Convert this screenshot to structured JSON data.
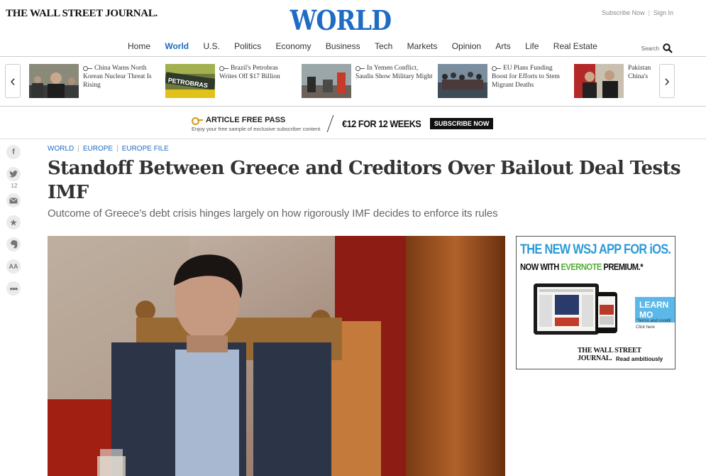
{
  "header": {
    "brand": "THE WALL STREET JOURNAL.",
    "section_title": "WORLD",
    "subscribe": "Subscribe Now",
    "signin": "Sign In",
    "search_label": "Search",
    "nav": [
      "Home",
      "World",
      "U.S.",
      "Politics",
      "Economy",
      "Business",
      "Tech",
      "Markets",
      "Opinion",
      "Arts",
      "Life",
      "Real Estate"
    ],
    "active_nav": "World"
  },
  "carousel": {
    "items": [
      {
        "text": "China Warns North Korean Nuclear Threat Is Rising",
        "thumb_text": ""
      },
      {
        "text": "Brazil's Petrobras Writes Off $17 Billion",
        "thumb_text": "PETROBRAS"
      },
      {
        "text": "In Yemen Conflict, Saudis Show Military Might",
        "thumb_text": ""
      },
      {
        "text": "EU Plans Funding Boost for Efforts to Stem Migrant Deaths",
        "thumb_text": ""
      },
      {
        "text": "Pakistan China's",
        "thumb_text": ""
      }
    ]
  },
  "promo": {
    "title": "ARTICLE FREE PASS",
    "subtitle": "Enjoy your free sample of exclusive subscriber content",
    "price": "€12 FOR 12 WEEKS",
    "button": "SUBSCRIBE NOW"
  },
  "share": {
    "twitter_count": "12"
  },
  "article": {
    "breadcrumbs": [
      "WORLD",
      "EUROPE",
      "EUROPE FILE"
    ],
    "headline": "Standoff Between Greece and Creditors Over Bailout Deal Tests IMF",
    "subhead": "Outcome of Greece’s debt crisis hinges largely on how rigorously IMF decides to enforce its rules"
  },
  "ad": {
    "title": "THE NEW WSJ APP FOR iOS.",
    "sub_prefix": "NOW WITH ",
    "sub_green": "EVERNOTE",
    "sub_suffix": " PREMIUM.*",
    "button": "LEARN MO",
    "terms_line1": "*Terms and conditi",
    "terms_line2": "Click here",
    "brand": "THE WALL STREET JOURNAL.",
    "tagline": "Read ambitiously"
  }
}
